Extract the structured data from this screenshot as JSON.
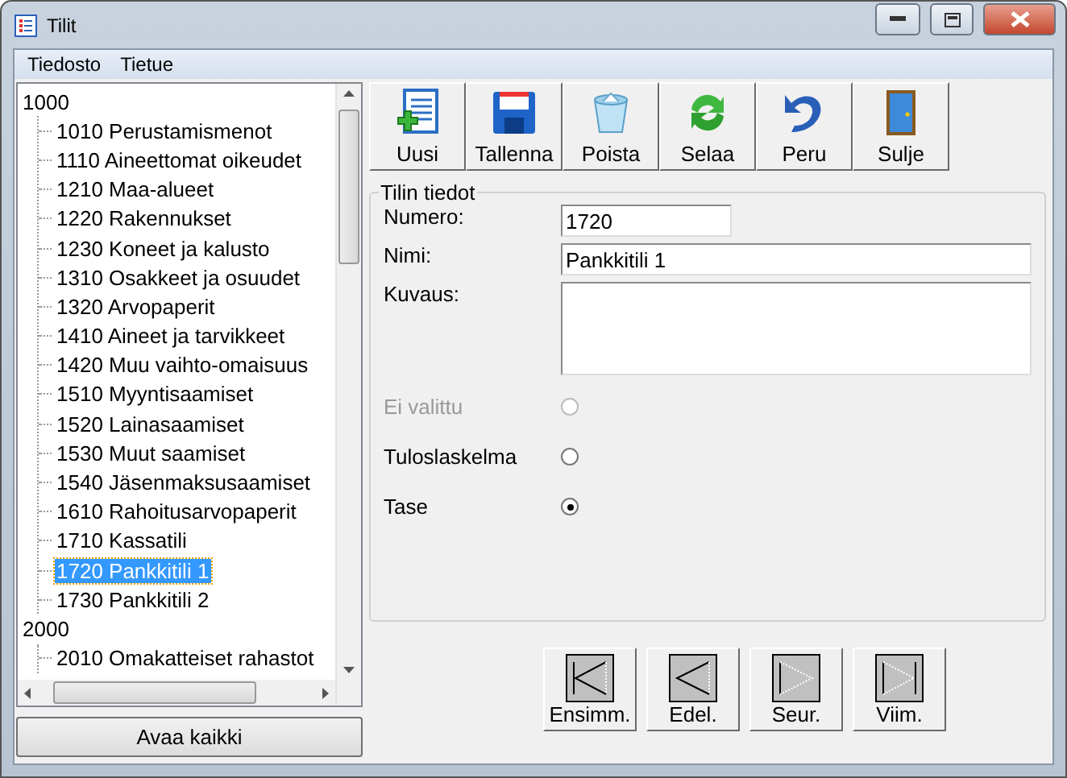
{
  "window": {
    "title": "Tilit"
  },
  "menu": [
    "Tiedosto",
    "Tietue"
  ],
  "tree": [
    {
      "label": "1000",
      "selected": false,
      "children": [
        {
          "label": "1010 Perustamismenot",
          "selected": false
        },
        {
          "label": "1110 Aineettomat oikeudet",
          "selected": false
        },
        {
          "label": "1210 Maa-alueet",
          "selected": false
        },
        {
          "label": "1220 Rakennukset",
          "selected": false
        },
        {
          "label": "1230 Koneet ja kalusto",
          "selected": false
        },
        {
          "label": "1310 Osakkeet ja osuudet",
          "selected": false
        },
        {
          "label": "1320 Arvopaperit",
          "selected": false
        },
        {
          "label": "1410 Aineet ja tarvikkeet",
          "selected": false
        },
        {
          "label": "1420 Muu vaihto-omaisuus",
          "selected": false
        },
        {
          "label": "1510 Myyntisaamiset",
          "selected": false
        },
        {
          "label": "1520 Lainasaamiset",
          "selected": false
        },
        {
          "label": "1530 Muut saamiset",
          "selected": false
        },
        {
          "label": "1540 Jäsenmaksusaamiset",
          "selected": false
        },
        {
          "label": "1610 Rahoitusarvopaperit",
          "selected": false
        },
        {
          "label": "1710 Kassatili",
          "selected": false
        },
        {
          "label": "1720 Pankkitili 1",
          "selected": true
        },
        {
          "label": "1730 Pankkitili 2",
          "selected": false
        }
      ]
    },
    {
      "label": "2000",
      "selected": false,
      "children": [
        {
          "label": "2010 Omakatteiset rahastot",
          "selected": false
        }
      ]
    }
  ],
  "expand_all_button": "Avaa kaikki",
  "toolbar": [
    "Uusi",
    "Tallenna",
    "Poista",
    "Selaa",
    "Peru",
    "Sulje"
  ],
  "group": {
    "title": "Tilin tiedot",
    "fields": [
      {
        "label": "Numero:",
        "value": "1720",
        "kind": "short"
      },
      {
        "label": "Nimi:",
        "value": "Pankkitili 1",
        "kind": "line"
      },
      {
        "label": "Kuvaus:",
        "kind": "multiline"
      }
    ],
    "radios": [
      {
        "label": "Ei valittu",
        "selected": false,
        "disabled": true
      },
      {
        "label": "Tuloslaskelma",
        "selected": false,
        "disabled": false
      },
      {
        "label": "Tase",
        "selected": true,
        "disabled": false
      }
    ]
  },
  "navigation": [
    "Ensimm.",
    "Edel.",
    "Seur.",
    "Viim."
  ]
}
